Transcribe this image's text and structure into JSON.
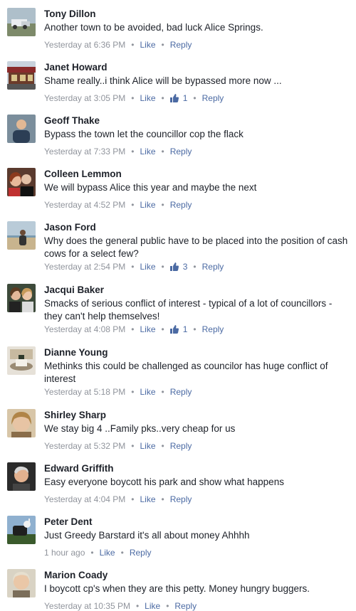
{
  "comments": [
    {
      "author": "Tony Dillon",
      "text": "Another town to be avoided, bad luck Alice Springs.",
      "time": "Yesterday at 6:36 PM",
      "like": "Like",
      "reply": "Reply",
      "likes": ""
    },
    {
      "author": "Janet Howard",
      "text": "Shame really..i think Alice will be bypassed more now ...",
      "time": "Yesterday at 3:05 PM",
      "like": "Like",
      "reply": "Reply",
      "likes": "1"
    },
    {
      "author": "Geoff Thake",
      "text": "Bypass the town let the councillor cop the flack",
      "time": "Yesterday at 7:33 PM",
      "like": "Like",
      "reply": "Reply",
      "likes": ""
    },
    {
      "author": "Colleen Lemmon",
      "text": "We will bypass Alice this year and maybe the next",
      "time": "Yesterday at 4:52 PM",
      "like": "Like",
      "reply": "Reply",
      "likes": ""
    },
    {
      "author": "Jason Ford",
      "text": "Why does the general public have to be placed into the position of cash cows for a select few?",
      "time": "Yesterday at 2:54 PM",
      "like": "Like",
      "reply": "Reply",
      "likes": "3"
    },
    {
      "author": "Jacqui Baker",
      "text": "Smacks of serious conflict of interest - typical of a lot of councillors - they can't help themselves!",
      "time": "Yesterday at 4:08 PM",
      "like": "Like",
      "reply": "Reply",
      "likes": "1"
    },
    {
      "author": "Dianne Young",
      "text": "Methinks this could be challenged as councilor has huge conflict of interest",
      "time": "Yesterday at 5:18 PM",
      "like": "Like",
      "reply": "Reply",
      "likes": ""
    },
    {
      "author": "Shirley Sharp",
      "text": "We stay big 4 ..Family pks..very cheap for us",
      "time": "Yesterday at 5:32 PM",
      "like": "Like",
      "reply": "Reply",
      "likes": ""
    },
    {
      "author": "Edward Griffith",
      "text": "Easy everyone boycott his park and show what happens",
      "time": "Yesterday at 4:04 PM",
      "like": "Like",
      "reply": "Reply",
      "likes": ""
    },
    {
      "author": "Peter Dent",
      "text": "Just Greedy Barstard it's all about money Ahhhh",
      "time": "1 hour ago",
      "like": "Like",
      "reply": "Reply",
      "likes": ""
    },
    {
      "author": "Marion Coady",
      "text": "I boycott cp's when they are this petty. Money hungry buggers.",
      "time": "Yesterday at 10:35 PM",
      "like": "Like",
      "reply": "Reply",
      "likes": ""
    }
  ],
  "colors": {
    "link": "#4b6aa3",
    "meta": "#90949c",
    "text": "#1d2129"
  },
  "icons": {
    "avatar": "profile-photo",
    "like": "thumbs-up-icon"
  }
}
